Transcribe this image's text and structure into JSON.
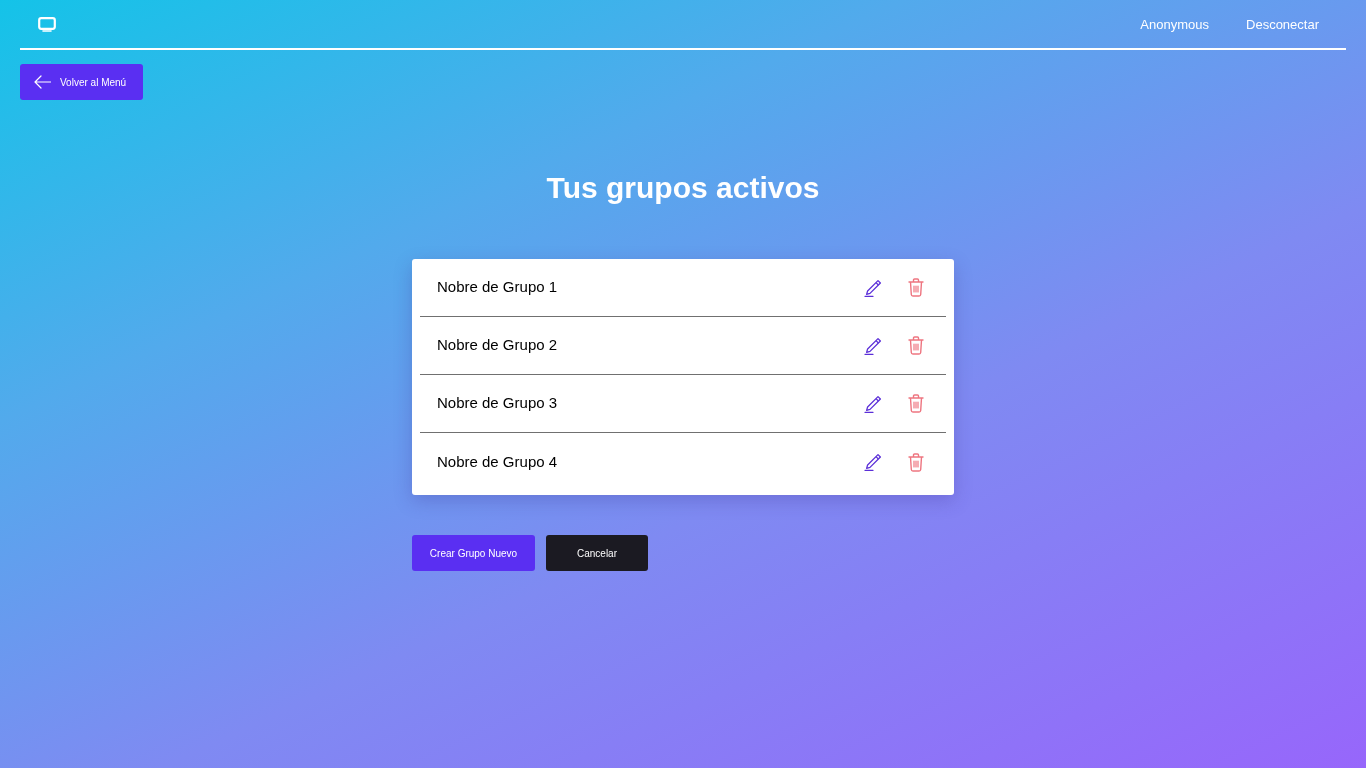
{
  "header": {
    "user": "Anonymous",
    "logout": "Desconectar"
  },
  "back_button": {
    "label": "Volver al Menú"
  },
  "title": "Tus grupos activos",
  "groups": [
    {
      "name": "Nobre de Grupo 1"
    },
    {
      "name": "Nobre de Grupo 2"
    },
    {
      "name": "Nobre de Grupo 3"
    },
    {
      "name": "Nobre de Grupo 4"
    }
  ],
  "buttons": [
    {
      "label": "Crear Grupo Nuevo",
      "kind": "primary"
    },
    {
      "label": "Cancelar",
      "kind": "secondary"
    }
  ]
}
